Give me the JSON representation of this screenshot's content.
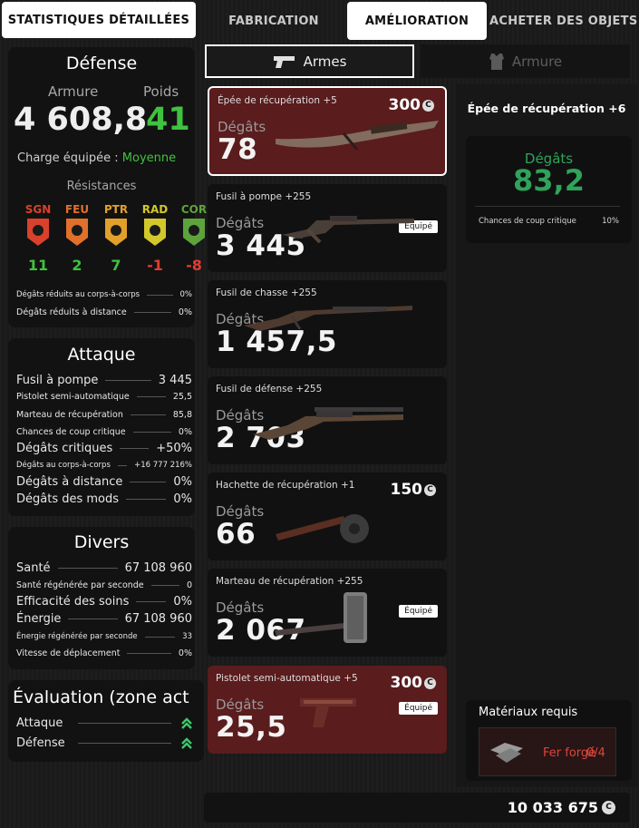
{
  "tabs": {
    "stats": "STATISTIQUES DÉTAILLÉES",
    "fabrication": "FABRICATION",
    "amelioration": "AMÉLIORATION",
    "acheter": "ACHETER DES OBJETS"
  },
  "subtabs": {
    "armes": "Armes",
    "armure": "Armure"
  },
  "defense": {
    "title": "Défense",
    "armure_label": "Armure",
    "poids_label": "Poids",
    "armure_value": "4 608,8",
    "poids_value": "41",
    "charge_label": "Charge équipée :",
    "charge_value": "Moyenne",
    "resistances_label": "Résistances",
    "resistances": [
      {
        "code": "SGN",
        "value": "11",
        "color": "#d9412c"
      },
      {
        "code": "FEU",
        "value": "2",
        "color": "#e0702b"
      },
      {
        "code": "PTR",
        "value": "7",
        "color": "#e2a02b"
      },
      {
        "code": "RAD",
        "value": "-1",
        "color": "#d2c82a"
      },
      {
        "code": "COR",
        "value": "-8",
        "color": "#5da33c"
      }
    ],
    "rows": [
      {
        "label": "Dégâts réduits au corps-à-corps",
        "value": "0%"
      },
      {
        "label": "Dégâts réduits à distance",
        "value": "0%"
      }
    ]
  },
  "attaque": {
    "title": "Attaque",
    "rows": [
      {
        "label": "Fusil à pompe",
        "value": "3 445"
      },
      {
        "label": "Pistolet semi-automatique",
        "value": "25,5"
      },
      {
        "label": "Marteau de récupération",
        "value": "85,8"
      },
      {
        "label": "Chances de coup critique",
        "value": "0%"
      },
      {
        "label": "Dégâts critiques",
        "value": "+50%"
      },
      {
        "label": "Dégâts au corps-à-corps",
        "value": "+16 777 216%"
      },
      {
        "label": "Dégâts à distance",
        "value": "0%"
      },
      {
        "label": "Dégâts des mods",
        "value": "0%"
      }
    ]
  },
  "divers": {
    "title": "Divers",
    "rows": [
      {
        "label": "Santé",
        "value": "67 108 960"
      },
      {
        "label": "Santé régénérée par seconde",
        "value": "0"
      },
      {
        "label": "Efficacité des soins",
        "value": "0%"
      },
      {
        "label": "Énergie",
        "value": "67 108 960"
      },
      {
        "label": "Énergie régénérée par seconde",
        "value": "33"
      },
      {
        "label": "Vitesse de déplacement",
        "value": "0%"
      }
    ]
  },
  "evaluation": {
    "title": "Évaluation (zone act",
    "rows": [
      {
        "label": "Attaque",
        "icon": "double-chevron-up-icon"
      },
      {
        "label": "Défense",
        "icon": "double-chevron-up-icon"
      }
    ]
  },
  "weapons": [
    {
      "name": "Épée de récupération +5",
      "damage_label": "Dégâts",
      "damage": "78",
      "price": "300",
      "equipped": "",
      "highlight": true,
      "selected": true
    },
    {
      "name": "Fusil à pompe +255",
      "damage_label": "Dégâts",
      "damage": "3 445",
      "price": "",
      "equipped": "Équipé",
      "highlight": false,
      "selected": false
    },
    {
      "name": "Fusil de chasse +255",
      "damage_label": "Dégâts",
      "damage": "1 457,5",
      "price": "",
      "equipped": "",
      "highlight": false,
      "selected": false
    },
    {
      "name": "Fusil de défense +255",
      "damage_label": "Dégâts",
      "damage": "2 703",
      "price": "",
      "equipped": "",
      "highlight": false,
      "selected": false
    },
    {
      "name": "Hachette de récupération +1",
      "damage_label": "Dégâts",
      "damage": "66",
      "price": "150",
      "equipped": "",
      "highlight": false,
      "selected": false
    },
    {
      "name": "Marteau de récupération +255",
      "damage_label": "Dégâts",
      "damage": "2 067",
      "price": "",
      "equipped": "Équipé",
      "highlight": false,
      "selected": false
    },
    {
      "name": "Pistolet semi-automatique +5",
      "damage_label": "Dégâts",
      "damage": "25,5",
      "price": "300",
      "equipped": "Équipé",
      "highlight": true,
      "selected": false
    }
  ],
  "detail": {
    "title": "Épée de récupération +6",
    "damage_label": "Dégâts",
    "damage": "83,2",
    "crit_label": "Chances de coup critique",
    "crit_value": "10%"
  },
  "materials": {
    "title": "Matériaux requis",
    "item_name": "Fer forgé",
    "item_count": "0/4"
  },
  "currency": {
    "amount": "10 033 675",
    "coin_symbol": "C"
  },
  "colors": {
    "positive": "#3fc23f",
    "negative": "#e23b2f",
    "detail_green": "#2fa35a",
    "card_red": "#5a1c1d"
  }
}
